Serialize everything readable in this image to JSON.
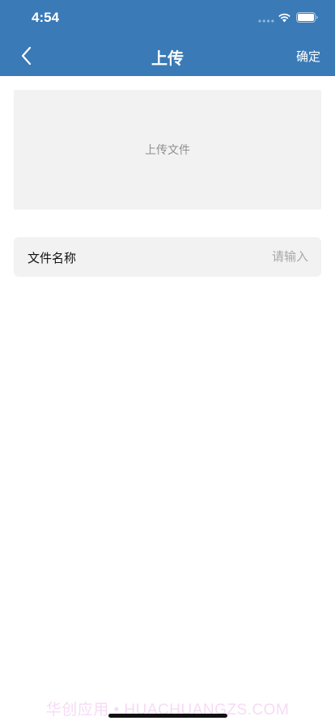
{
  "status_bar": {
    "time": "4:54"
  },
  "nav": {
    "title": "上传",
    "confirm_label": "确定",
    "back_icon": "chevron-left-icon"
  },
  "upload": {
    "label": "上传文件"
  },
  "file_name": {
    "label": "文件名称",
    "value": "",
    "placeholder": "请输入"
  },
  "watermark": "华创应用 • HUACHUANGZS.COM",
  "colors": {
    "header_bg": "#3a7ab6",
    "field_bg": "#f2f2f2",
    "placeholder": "#a8a8a8"
  }
}
